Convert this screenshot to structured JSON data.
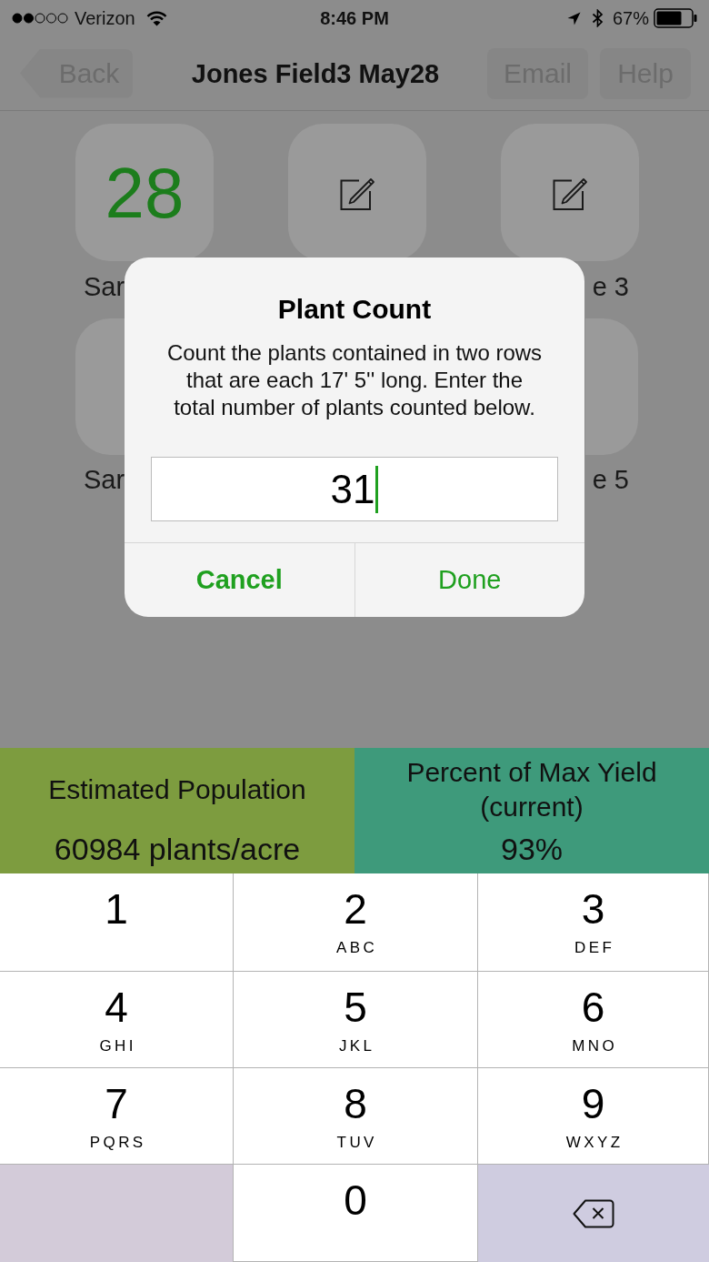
{
  "status_bar": {
    "carrier": "Verizon",
    "time": "8:46 PM",
    "battery": "67%"
  },
  "nav_bar": {
    "back_button": "Back",
    "title": "Jones Field3 May28",
    "buttons": [
      "Email",
      "Help"
    ]
  },
  "samples": {
    "rows": [
      {
        "tiles": [
          {
            "kind": "count",
            "value": "28"
          },
          {
            "kind": "edit"
          },
          {
            "kind": "edit"
          }
        ],
        "labels": [
          "Sar",
          "e 3"
        ]
      },
      {
        "tiles": [
          {
            "kind": "partial_left"
          },
          {
            "kind": "partial_right"
          }
        ],
        "labels": [
          "Sar",
          "e 5"
        ]
      }
    ]
  },
  "dialog": {
    "title": "Plant Count",
    "message": "Count the plants contained in two rows that are each 17' 5'' long. Enter the total number of plants counted below.",
    "input": {
      "value": "31",
      "focused": true
    },
    "buttons": [
      {
        "label": "Cancel",
        "preferred": true
      },
      {
        "label": "Done",
        "preferred": false
      }
    ]
  },
  "panels": [
    {
      "label": "Estimated Population",
      "value": "60984 plants/acre",
      "color": "#7d9c3f"
    },
    {
      "label": "Percent of Max Yield (current)",
      "value": "93%",
      "color": "#3e9a7b"
    }
  ],
  "keypad": {
    "rows": [
      [
        {
          "kind": "digit",
          "digit": "1"
        },
        {
          "kind": "digit",
          "digit": "2",
          "letters": "ABC"
        },
        {
          "kind": "digit",
          "digit": "3",
          "letters": "DEF"
        }
      ],
      [
        {
          "kind": "digit",
          "digit": "4",
          "letters": "GHI"
        },
        {
          "kind": "digit",
          "digit": "5",
          "letters": "JKL"
        },
        {
          "kind": "digit",
          "digit": "6",
          "letters": "MNO"
        }
      ],
      [
        {
          "kind": "digit",
          "digit": "7",
          "letters": "PQRS"
        },
        {
          "kind": "digit",
          "digit": "8",
          "letters": "TUV"
        },
        {
          "kind": "digit",
          "digit": "9",
          "letters": "WXYZ"
        }
      ],
      [
        {
          "kind": "blank"
        },
        {
          "kind": "digit",
          "digit": "0"
        },
        {
          "kind": "delete"
        }
      ]
    ]
  }
}
